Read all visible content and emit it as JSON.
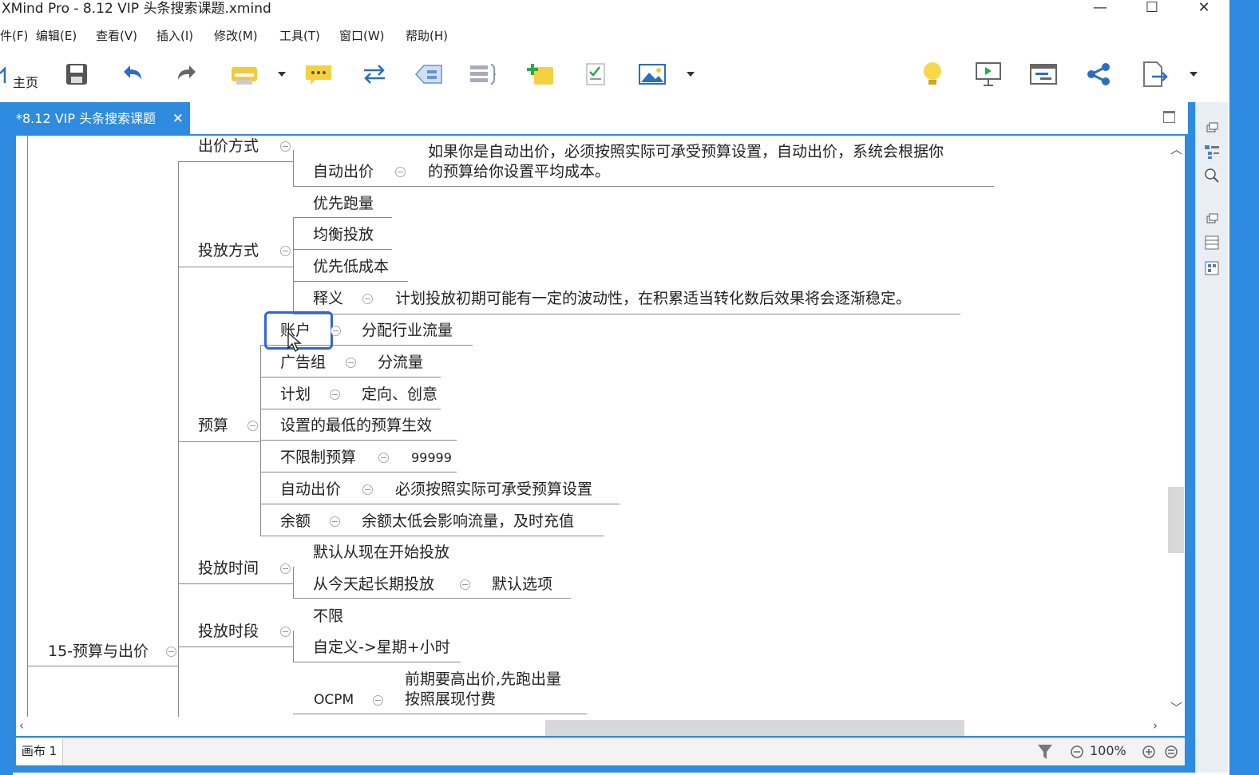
{
  "window": {
    "title": "XMind Pro - 8.12 VIP 头条搜索课题.xmind",
    "minimize": "—",
    "maximize": "☐",
    "close": "✕"
  },
  "menu": {
    "items": [
      "件(F)",
      "编辑(E)",
      "查看(V)",
      "插入(I)",
      "修改(M)",
      "工具(T)",
      "窗口(W)",
      "帮助(H)"
    ]
  },
  "toolbar": {
    "home_label": "主页"
  },
  "tab": {
    "label": "*8.12 VIP 头条搜索课题",
    "close": "✕"
  },
  "mindmap": {
    "root": "15-预算与出价",
    "bid_method": {
      "label": "出价方式",
      "auto_bid": "自动出价",
      "auto_bid_note_line1": "如果你是自动出价，必须按照实际可承受预算设置，自动出价，系统会根据你",
      "auto_bid_note_line2": "的预算给你设置平均成本。"
    },
    "delivery_method": {
      "label": "投放方式",
      "options": [
        "优先跑量",
        "均衡投放",
        "优先低成本"
      ],
      "explain": "释义",
      "explain_note": "计划投放初期可能有一定的波动性，在积累适当转化数后效果将会逐渐稳定。"
    },
    "budget": {
      "label": "预算",
      "rows": [
        {
          "label": "账户",
          "note": "分配行业流量"
        },
        {
          "label": "广告组",
          "note": "分流量"
        },
        {
          "label": "计划",
          "note": "定向、创意"
        },
        {
          "label": "设置的最低的预算生效",
          "note": ""
        },
        {
          "label": "不限制预算",
          "note": "99999"
        },
        {
          "label": "自动出价",
          "note": "必须按照实际可承受预算设置"
        },
        {
          "label": "余额",
          "note": "余额太低会影响流量，及时充值"
        }
      ]
    },
    "delivery_time": {
      "label": "投放时间",
      "default_now": "默认从现在开始投放",
      "long_term": "从今天起长期投放",
      "long_term_note": "默认选项"
    },
    "delivery_period": {
      "label": "投放时段",
      "unlimited": "不限",
      "custom": "自定义->星期+小时"
    },
    "ocpm": {
      "label": "OCPM",
      "note_line1": "前期要高出价,先跑出量",
      "note_line2": "按照展现付费"
    }
  },
  "status": {
    "sheet": "画布 1",
    "zoom": "100%"
  }
}
